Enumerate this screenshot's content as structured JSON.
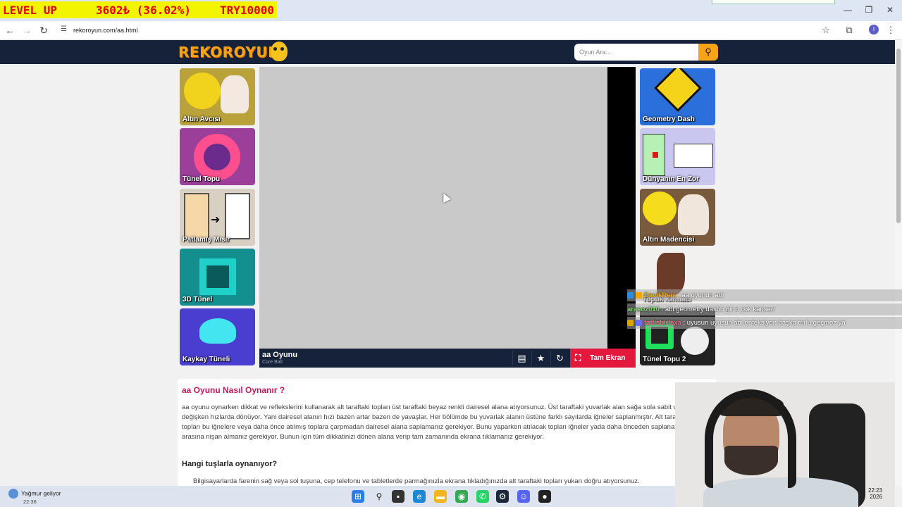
{
  "stream_overlay": {
    "level": "LEVEL UP",
    "amount": "3602₺ (36.02%)",
    "goal": "TRY10000"
  },
  "browser": {
    "url": "rekoroyun.com/aa.html",
    "window_controls": {
      "minimize": "—",
      "restore": "❐",
      "close": "✕"
    }
  },
  "site": {
    "logo": "REKOROYUN",
    "search": {
      "placeholder": "Oyun Ara..."
    }
  },
  "left_games": [
    {
      "label": "Altın Avcısı",
      "color": "#b9a23a"
    },
    {
      "label": "Tünel Topu",
      "color": "#9c3f9a"
    },
    {
      "label": "Patlamış Mısır",
      "color": "#d8d0c2"
    },
    {
      "label": "3D Tünel",
      "color": "#138f8f"
    },
    {
      "label": "Kaykay Tüneli",
      "color": "#4a3ed1"
    }
  ],
  "right_games": [
    {
      "label": "Geometry Dash",
      "color": "#2a6fdb"
    },
    {
      "label": "Dünyanın En Zor",
      "color": "#c9c6ef"
    },
    {
      "label": "Altın Madencisi",
      "color": "#7a5a3c"
    },
    {
      "label": "Topuk Kırmacı",
      "color": "#f3f1ef"
    },
    {
      "label": "Tünel Topu 2",
      "color": "#222222"
    }
  ],
  "game": {
    "title": "aa Oyunu",
    "subtitle": "Core Ball",
    "fullscreen_label": "Tam Ekran"
  },
  "chat": [
    {
      "user": "DavikReis",
      "message": ": aa oyunun adı",
      "user_color": "#ffb000"
    },
    {
      "user": "arasoz010",
      "message": ": abi geometry dashh gir o çok kanserr",
      "user_color": "#7dd96b"
    },
    {
      "user": "tatlisbirlexa",
      "message": ": uyusun uyusun abi enfeksiyon başka turlu geçmez ya",
      "user_color": "#ff6a8e"
    }
  ],
  "article": {
    "heading": "aa Oyunu Nasıl Oynanır ?",
    "body": "aa oyunu oynarken dikkat ve reflekslerini kullanarak alt taraftaki topları üst taraftaki beyaz renkli dairesel alana atıyorsunuz. Üst taraftaki yuvarlak alan sağa sola sabit veya değişken hızlarda dönüyor. Yani dairesel alanın hızı bazen artar bazen de yavaşlar. Her bölümde bu yuvarlak alanın üstüne farklı sayılarda iğneler saplanmıştır. Alt taraftaki tüm topları bu iğnelere veya daha önce atılmış toplara çarpmadan dairesel alana saplamanız gerekiyor. Bunu yaparken atılacak topları iğneler yada daha önceden saplanan topların arasına nişan almanız gerekiyor. Bunun için tüm dikkatinizi dönen alana verip tam zamanında ekrana tıklamanız gerekiyor.",
    "controls_heading": "Hangi tuşlarla oynanıyor?",
    "controls_item": "Bilgisayarlarda farenin sağ veya sol tuşuna, cep telefonu ve tabletlerde parmağınızla ekrana tıkladığınızda alt taraftaki topları yukarı doğru atıyorsunuz."
  },
  "taskbar": {
    "weather_label": "Yağmur geliyor",
    "weather_time": "22:36",
    "clock": "22:23",
    "date": "2026"
  }
}
